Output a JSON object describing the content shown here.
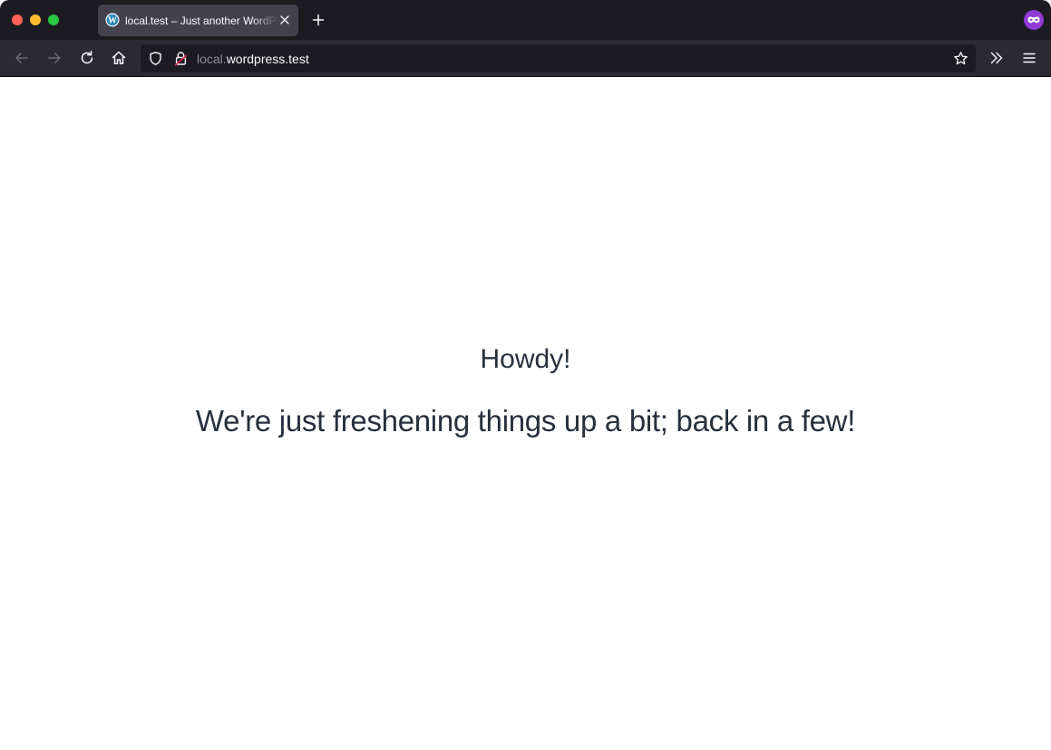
{
  "window": {
    "traffic_lights": [
      "close",
      "minimize",
      "maximize"
    ]
  },
  "tab": {
    "title": "local.test – Just another WordPress site",
    "favicon": "wordpress-icon",
    "close_icon": "close-icon"
  },
  "toolbar": {
    "new_tab_icon": "plus-icon",
    "private_icon": "private-browsing-mask-icon",
    "back_icon": "arrow-left-icon",
    "forward_icon": "arrow-right-icon",
    "reload_icon": "reload-icon",
    "home_icon": "home-icon",
    "bookmark_icon": "star-icon",
    "overflow_icon": "chevron-double-right-icon",
    "menu_icon": "hamburger-menu-icon"
  },
  "urlbar": {
    "host_prefix": "local.",
    "host_main": "wordpress.test",
    "tracking_icon": "shield-icon",
    "security_icon": "insecure-lock-icon"
  },
  "page": {
    "greeting": "Howdy!",
    "message": "We're just freshening things up a bit; back in a few!"
  },
  "colors": {
    "tabstrip_bg": "#1c1b22",
    "tab_active_bg": "#42414d",
    "navbar_bg": "#2b2a33",
    "urlbar_bg": "#1c1b22",
    "page_text": "#28303d",
    "private_purple": "#8f3bd6",
    "insecure_red": "#e22850"
  }
}
